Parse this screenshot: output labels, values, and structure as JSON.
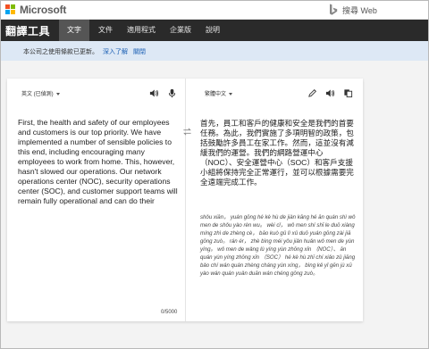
{
  "header": {
    "brand": "Microsoft",
    "search_label": "搜尋 Web"
  },
  "nav": {
    "app_title": "翻譯工具",
    "items": [
      {
        "label": "文字",
        "active": true
      },
      {
        "label": "文件",
        "active": false
      },
      {
        "label": "適用程式",
        "active": false
      },
      {
        "label": "企業版",
        "active": false
      },
      {
        "label": "說明",
        "active": false
      }
    ]
  },
  "notice": {
    "text": "本公司之使用條款已更新。",
    "learn_more": "深入了解",
    "close": "關閉"
  },
  "translator": {
    "source_lang": "英文 (已偵測)",
    "target_lang": "繁體中文",
    "source_text": "First, the health and safety of our employees and customers is our top priority. We have implemented a number of sensible policies to this end, including encouraging many employees to work from home. This, however, hasn't slowed our operations. Our network operations center (NOC), security operations center (SOC), and customer support teams will remain fully operational and can do their",
    "char_count": "0/5000",
    "target_text": "首先，員工和客戶的健康和安全是我們的首要任務。為此，我們實施了多項明智的政策，包括鼓勵許多員工在家工作。然而，這並沒有減緩我們的運營。我們的網路營運中心（NOC）、安全運營中心（SOC）和客戶支援小組將保持完全正常運行，並可以根據需要完全遠端完成工作。",
    "pinyin": "shǒu xiān， yuán gōng hé kè hù de jiàn kāng hé ān quán shì wǒ men de shǒu yào rèn wu。 wèi cǐ， wǒ men shí shī le duō xiàng míng zhì de zhèng cè， bāo kuò gǔ lì xǔ duō yuán gōng zài jiā gōng zuò。 rán ér， zhè bìng méi yǒu jiǎn huǎn wǒ men de yùn yíng。 wǒ men de wǎng lù yíng yùn zhōng xīn （NOC）、 ān quán yùn yíng zhōng xīn （SOC） hé kè hù zhī chí xiǎo zǔ jiāng bǎo chí wán quán zhèng cháng yùn xíng， bìng kě yǐ gēn jù xū yào wán quán yuǎn duān wán chéng gōng zuò。"
  },
  "colors": {
    "ms_red": "#f25022",
    "ms_green": "#7fba00",
    "ms_blue": "#00a4ef",
    "ms_yellow": "#ffb900",
    "nav_bg": "#2a2a2a",
    "notice_bg": "#dde8f5",
    "link": "#1a5fb4"
  },
  "icons": {
    "source_speaker": "speaker-icon",
    "source_mic": "microphone-icon",
    "swap": "swap-icon",
    "edit": "pencil-icon",
    "target_speaker": "speaker-icon",
    "copy": "copy-icon"
  }
}
